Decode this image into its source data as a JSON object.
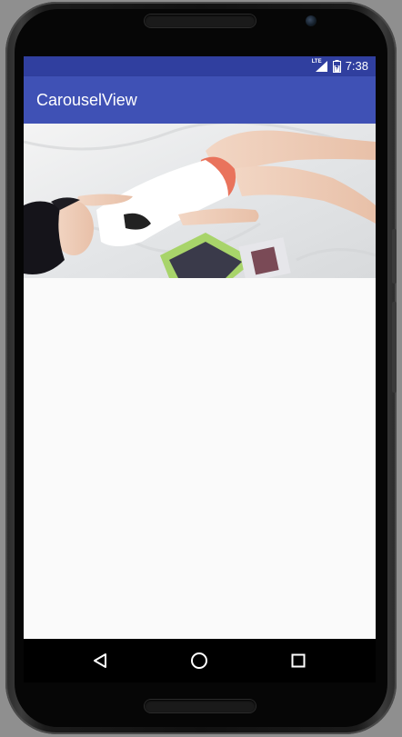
{
  "status_bar": {
    "network_label": "LTE",
    "time": "7:38"
  },
  "app_bar": {
    "title": "CarouselView"
  },
  "carousel": {
    "content": "photo"
  },
  "nav_bar": {
    "back_icon": "back-triangle-icon",
    "home_icon": "home-circle-icon",
    "recents_icon": "recents-square-icon"
  },
  "colors": {
    "status_bar": "#303f9f",
    "app_bar": "#3f51b5",
    "content_bg": "#fafafa"
  }
}
